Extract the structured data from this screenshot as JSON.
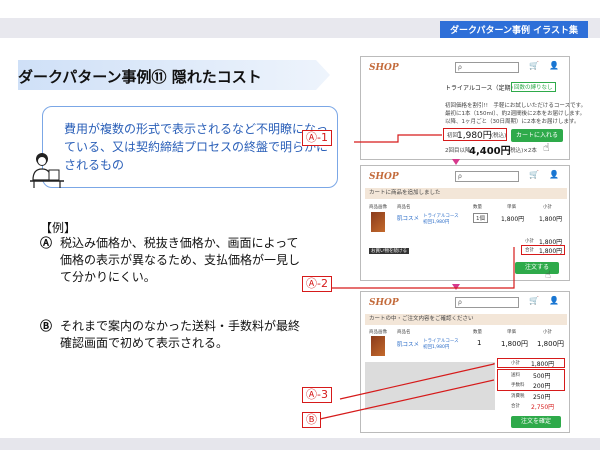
{
  "header": {
    "title": "ダークパターン事例 イラスト集"
  },
  "slide": {
    "title": "ダークパターン事例⑪  隠れたコスト",
    "info": "費用が複数の形式で表示されるなど不明瞭になっている、又は契約締結プロセスの終盤で明らかにされるもの",
    "example_head": "【例】",
    "example_a_mark": "Ⓐ",
    "example_a_text": "税込み価格か、税抜き価格か、画面によって価格の表示が異なるため、支払価格が一見して分かりにくい。",
    "example_b_mark": "Ⓑ",
    "example_b_text": "それまで案内のなかった送料・手数料が最終確認画面で初めて表示される。"
  },
  "labels": {
    "a1": "Ⓐ-1",
    "a2": "Ⓐ-2",
    "a3": "Ⓐ-3",
    "b": "Ⓑ"
  },
  "screen1": {
    "logo": "SHOP",
    "search": "ρ",
    "course": "トライアルコース（定期）",
    "badge": "回数の縛りなし",
    "desc1": "初回価格を割引!!　手軽にお試しいただけるコースです。",
    "desc2": "最初に1本（150ml）、約2週間後に2本をお届けします。",
    "desc3": "以降、1ヶ月ごと（30日周期）に2本をお届けします。",
    "first_label": "初回",
    "first_price": "1,980円",
    "first_tax": "(税込)",
    "second_label": "2回目以降",
    "second_price": "4,400円",
    "second_note": "(税込)×2本",
    "cart_btn": "カートに入れる"
  },
  "screen2": {
    "logo": "SHOP",
    "search": "ρ",
    "bar": "カートに商品を追加しました",
    "col_img": "商品画像",
    "col_name": "商品名",
    "col_qty": "数量",
    "col_price": "単価",
    "col_sub": "小計",
    "item_name": "肌コスメ",
    "item_course": "トライアルコース",
    "item_first": "初回1,980円",
    "qty": "1個",
    "price": "1,800円",
    "subtotal": "1,800円",
    "sum_label": "小計",
    "sum_value": "1,800円",
    "total_label": "合計",
    "total_value": "1,800円",
    "back_btn": "お買い物を続ける",
    "order_btn": "注文する"
  },
  "screen3": {
    "logo": "SHOP",
    "search": "ρ",
    "bar": "カートの中・ご注文内容をご確認ください",
    "col_img": "商品画像",
    "col_name": "商品名",
    "col_qty": "数量",
    "col_price": "単価",
    "col_sub": "小計",
    "item_name": "肌コスメ",
    "item_course": "トライアルコース",
    "item_first": "初回1,980円",
    "qty": "1",
    "price": "1,800円",
    "subtotal": "1,800円",
    "sum_label": "小計",
    "sum_value": "1,800円",
    "ship_label": "送料",
    "ship_value": "500円",
    "fee_label": "手数料",
    "fee_value": "200円",
    "tax_label": "消費税",
    "tax_value": "250円",
    "total_label": "合計",
    "total_value": "2,750円",
    "confirm_btn": "注文を確定"
  }
}
